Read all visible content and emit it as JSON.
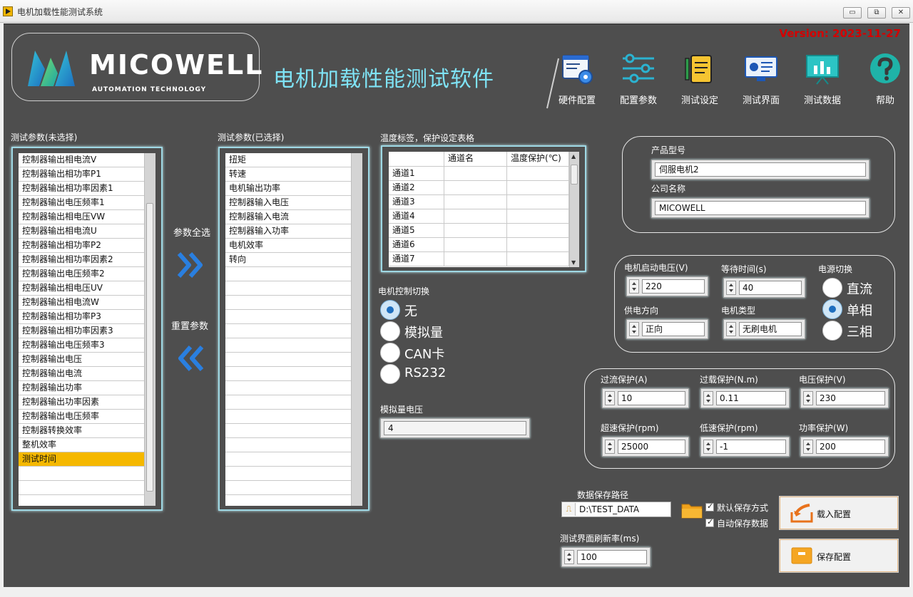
{
  "window": {
    "title": "电机加载性能测试系统",
    "minimize": "▭",
    "restore": "⧉",
    "close": "✕"
  },
  "version": "Version: 2023-11-27",
  "logo": {
    "brand": "MICOWELL",
    "tagline": "AUTOMATION TECHNOLOGY"
  },
  "app_title": "电机加载性能测试软件",
  "toolbar": [
    {
      "label": "硬件配置",
      "icon": "hardware-config-icon"
    },
    {
      "label": "配置参数",
      "icon": "sliders-icon"
    },
    {
      "label": "测试设定",
      "icon": "notepad-icon"
    },
    {
      "label": "测试界面",
      "icon": "monitor-chart-icon"
    },
    {
      "label": "测试数据",
      "icon": "data-board-icon"
    },
    {
      "label": "帮助",
      "icon": "help-icon"
    }
  ],
  "unselected": {
    "title": "测试参数(未选择)",
    "items": [
      "控制器输出相电流V",
      "控制器输出相功率P1",
      "控制器输出相功率因素1",
      "控制器输出电压频率1",
      "控制器输出相电压VW",
      "控制器输出相电流U",
      "控制器输出相功率P2",
      "控制器输出相功率因素2",
      "控制器输出电压频率2",
      "控制器输出相电压UV",
      "控制器输出相电流W",
      "控制器输出相功率P3",
      "控制器输出相功率因素3",
      "控制器输出电压频率3",
      "控制器输出电压",
      "控制器输出电流",
      "控制器输出功率",
      "控制器输出功率因素",
      "控制器输出电压频率",
      "控制器转换效率",
      "整机效率",
      "测试时间",
      "",
      "",
      "",
      ""
    ],
    "selected_index": 21
  },
  "selected": {
    "title": "测试参数(已选择)",
    "items": [
      "扭矩",
      "转速",
      "电机输出功率",
      "控制器输入电压",
      "控制器输入电流",
      "控制器输入功率",
      "电机效率",
      "转向",
      "",
      "",
      "",
      "",
      "",
      "",
      "",
      "",
      "",
      "",
      "",
      "",
      "",
      "",
      "",
      "",
      "",
      ""
    ]
  },
  "select_all_label": "参数全选",
  "reset_label": "重置参数",
  "temp_table": {
    "title": "温度标签，保护设定表格",
    "headers": [
      "",
      "通道名",
      "温度保护(℃)"
    ],
    "rows": [
      "通道1",
      "通道2",
      "通道3",
      "通道4",
      "通道5",
      "通道6",
      "通道7"
    ]
  },
  "motor_control": {
    "title": "电机控制切换",
    "options": [
      "无",
      "模拟量",
      "CAN卡",
      "RS232"
    ],
    "selected": 0
  },
  "analog_voltage": {
    "label": "模拟量电压",
    "value": "4"
  },
  "product": {
    "model_label": "产品型号",
    "model_value": "伺服电机2",
    "company_label": "公司名称",
    "company_value": "MICOWELL"
  },
  "startup": {
    "voltage_label": "电机启动电压(V)",
    "voltage_value": "220",
    "wait_label": "等待时间(s)",
    "wait_value": "40",
    "direction_label": "供电方向",
    "direction_value": "正向",
    "motor_type_label": "电机类型",
    "motor_type_value": "无刷电机",
    "power_switch_label": "电源切换",
    "power_options": [
      "直流",
      "单相",
      "三相"
    ],
    "power_selected": 1
  },
  "protection": {
    "overcurrent_label": "过流保护(A)",
    "overcurrent_value": "10",
    "overload_label": "过载保护(N.m)",
    "overload_value": "0.11",
    "voltage_label": "电压保护(V)",
    "voltage_value": "230",
    "overspeed_label": "超速保护(rpm)",
    "overspeed_value": "25000",
    "underspeed_label": "低速保护(rpm)",
    "underspeed_value": "-1",
    "power_label": "功率保护(W)",
    "power_value": "200"
  },
  "save": {
    "path_label": "数据保存路径",
    "path_value": "D:\\TEST_DATA",
    "default_save_label": "默认保存方式",
    "auto_save_label": "自动保存数据",
    "refresh_label": "测试界面刷新率(ms)",
    "refresh_value": "100"
  },
  "buttons": {
    "load_config": "载入配置",
    "save_config": "保存配置"
  },
  "colors": {
    "background": "#4e4e4e",
    "accent": "#7fe3f5",
    "selected_row": "#f5b800",
    "version": "#d40000"
  }
}
